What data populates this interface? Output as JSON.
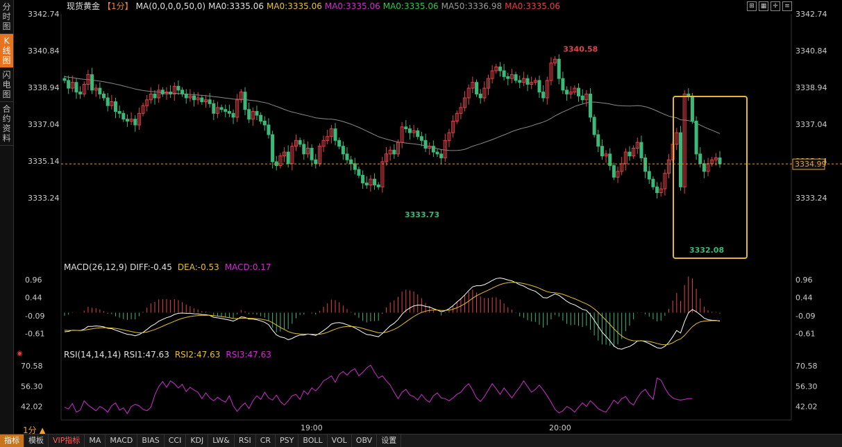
{
  "sidebar": {
    "tabs": [
      {
        "label": "分时图",
        "active": false
      },
      {
        "label": "K线图",
        "active": true
      },
      {
        "label": "闪电图",
        "active": false
      },
      {
        "label": "合约资料",
        "active": false
      }
    ]
  },
  "header": {
    "title": "现货黄金",
    "period_tag": "【1分】",
    "ma_params": "MA(0,0,0,0,50,0)",
    "ma_items": [
      {
        "label": "MA0:3335.06",
        "color": "#e0e0e0"
      },
      {
        "label": "MA0:3335.06",
        "color": "#e8c22a"
      },
      {
        "label": "MA0:3335.06",
        "color": "#d22bd2"
      },
      {
        "label": "MA0:3335.06",
        "color": "#2ec94a"
      },
      {
        "label": "MA50:3336.98",
        "color": "#9a9a9a"
      },
      {
        "label": "MA0:3335.06",
        "color": "#e84040"
      }
    ]
  },
  "colors": {
    "up": "#e8404a",
    "down": "#3cb878",
    "ma50": "#8a8a8a",
    "dif": "#ffffff",
    "dea": "#e8c22a",
    "rsi": "#d22bd2",
    "highlight_box": "#e8b82a",
    "last_price_line": "#e8a030"
  },
  "chart_data": [
    {
      "type": "candlestick",
      "name": "price",
      "ylim": [
        3331.8,
        3342.74
      ],
      "y_ticks": [
        3342.74,
        3340.84,
        3338.94,
        3337.04,
        3335.14,
        3333.24
      ],
      "x_tick_labels": [
        "19:00",
        "20:00"
      ],
      "high_label": "3340.58",
      "low_labels": [
        "3333.73",
        "3332.08"
      ],
      "last_price": "3334.99",
      "ma50_label": "MA50",
      "closes": [
        3339.3,
        3338.9,
        3339.2,
        3338.7,
        3338.6,
        3339.1,
        3339.6,
        3338.8,
        3338.9,
        3338.6,
        3338.4,
        3338.0,
        3338.2,
        3337.7,
        3337.6,
        3337.3,
        3337.2,
        3337.3,
        3337.0,
        3337.6,
        3338.0,
        3338.3,
        3338.6,
        3338.4,
        3338.8,
        3338.6,
        3338.7,
        3338.6,
        3339.0,
        3338.8,
        3338.6,
        3338.4,
        3338.5,
        3338.3,
        3338.4,
        3338.2,
        3338.3,
        3338.1,
        3337.6,
        3337.9,
        3337.8,
        3337.7,
        3337.6,
        3337.4,
        3338.3,
        3338.7,
        3337.8,
        3337.3,
        3337.7,
        3337.5,
        3337.2,
        3337.0,
        3336.5,
        3335.1,
        3334.9,
        3335.4,
        3335.6,
        3335.0,
        3335.9,
        3336.2,
        3336.0,
        3335.5,
        3335.8,
        3335.2,
        3335.0,
        3335.9,
        3336.2,
        3336.4,
        3336.8,
        3336.2,
        3335.9,
        3335.5,
        3335.2,
        3335.0,
        3334.7,
        3334.4,
        3334.0,
        3333.9,
        3334.2,
        3333.9,
        3333.8,
        3335.1,
        3335.5,
        3335.7,
        3335.5,
        3336.1,
        3336.9,
        3336.8,
        3336.6,
        3336.7,
        3336.4,
        3336.2,
        3335.8,
        3335.9,
        3335.6,
        3335.5,
        3335.3,
        3336.2,
        3336.6,
        3337.2,
        3337.6,
        3337.9,
        3338.4,
        3338.9,
        3339.2,
        3338.6,
        3338.4,
        3338.9,
        3339.4,
        3339.8,
        3340.0,
        3339.8,
        3339.5,
        3339.4,
        3339.6,
        3339.3,
        3339.2,
        3339.4,
        3339.1,
        3339.2,
        3339.3,
        3338.7,
        3338.4,
        3339.3,
        3340.2,
        3340.4,
        3339.4,
        3338.8,
        3338.6,
        3338.7,
        3338.9,
        3338.5,
        3338.3,
        3338.6,
        3337.4,
        3336.5,
        3335.9,
        3335.4,
        3335.5,
        3334.9,
        3334.3,
        3334.6,
        3335.0,
        3335.6,
        3335.4,
        3335.8,
        3336.1,
        3335.3,
        3334.6,
        3334.2,
        3333.8,
        3333.5,
        3333.7,
        3334.5,
        3335.2,
        3336.0,
        3336.6,
        3333.8,
        3338.6,
        3338.5,
        3337.2,
        3335.5,
        3335.0,
        3334.6,
        3335.0,
        3335.2,
        3335.3,
        3334.99
      ]
    },
    {
      "type": "line",
      "name": "macd",
      "label": "MACD(26,12,9)",
      "values_text": {
        "dif": "DIFF:-0.45",
        "dea": "DEA:-0.53",
        "macd": "MACD:0.17"
      },
      "ylim": [
        -1.0,
        1.1
      ],
      "y_ticks": [
        "0.96",
        "0.44",
        "-0.09",
        "-0.61"
      ]
    },
    {
      "type": "line",
      "name": "rsi",
      "label": "RSI(14,14,14)",
      "values_text": {
        "rsi1": "RSI1:47.63",
        "rsi2": "RSI2:47.63",
        "rsi3": "RSI3:47.63"
      },
      "ylim": [
        35,
        73
      ],
      "y_ticks": [
        "70.58",
        "56.30",
        "42.02"
      ],
      "values": [
        41.5,
        40.2,
        44.0,
        38.0,
        39.5,
        46.0,
        43.0,
        41.0,
        39.0,
        42.0,
        40.5,
        38.0,
        42.5,
        44.5,
        39.5,
        41.0,
        37.0,
        42.0,
        43.5,
        42.5,
        40.0,
        39.0,
        41.5,
        50.0,
        56.0,
        59.5,
        55.5,
        60.0,
        58.0,
        55.0,
        57.5,
        52.5,
        55.5,
        53.5,
        52.0,
        47.5,
        51.5,
        48.0,
        46.0,
        48.5,
        46.5,
        45.0,
        49.5,
        42.5,
        38.5,
        42.0,
        44.5,
        40.5,
        46.0,
        49.5,
        47.0,
        52.0,
        48.0,
        46.5,
        50.0,
        45.5,
        43.0,
        46.0,
        49.5,
        50.5,
        47.0,
        53.0,
        50.5,
        55.0,
        53.0,
        56.0,
        60.0,
        61.5,
        63.5,
        59.0,
        64.5,
        66.5,
        64.0,
        67.0,
        68.5,
        63.5,
        66.0,
        69.0,
        71.0,
        66.0,
        62.0,
        63.5,
        60.0,
        57.0,
        52.0,
        47.5,
        52.0,
        54.0,
        50.0,
        49.0,
        46.5,
        50.5,
        47.0,
        45.0,
        49.5,
        51.5,
        48.0,
        47.5,
        46.0,
        48.0,
        50.5,
        52.0,
        55.5,
        58.0,
        53.5,
        48.0,
        45.5,
        49.0,
        53.5,
        58.0,
        54.5,
        50.5,
        55.0,
        51.5,
        48.0,
        52.0,
        55.5,
        60.0,
        56.0,
        52.0,
        54.0,
        57.0,
        53.5,
        49.5,
        45.0,
        40.0,
        37.5,
        39.0,
        42.0,
        40.5,
        38.0,
        41.5,
        44.5,
        42.0,
        46.0,
        43.5,
        40.5,
        39.0,
        38.0,
        42.0,
        46.5,
        44.0,
        47.5,
        49.0,
        45.0,
        43.0,
        48.0,
        52.0,
        54.0,
        50.0,
        47.0,
        62.0,
        60.5,
        55.0,
        50.5,
        48.0,
        47.0,
        46.5,
        47.0,
        47.5,
        47.63
      ]
    }
  ],
  "toolbar": {
    "period_label": "1分",
    "items": [
      {
        "label": "指标",
        "kind": "first"
      },
      {
        "label": "模板",
        "kind": "normal"
      },
      {
        "label": "VIP指标",
        "kind": "vip"
      },
      {
        "label": "MA",
        "kind": "normal"
      },
      {
        "label": "MACD",
        "kind": "normal"
      },
      {
        "label": "BIAS",
        "kind": "normal"
      },
      {
        "label": "CCI",
        "kind": "normal"
      },
      {
        "label": "KDJ",
        "kind": "normal"
      },
      {
        "label": "LW&",
        "kind": "normal"
      },
      {
        "label": "RSI",
        "kind": "normal"
      },
      {
        "label": "CR",
        "kind": "normal"
      },
      {
        "label": "PSY",
        "kind": "normal"
      },
      {
        "label": "BOLL",
        "kind": "normal"
      },
      {
        "label": "VOL",
        "kind": "normal"
      },
      {
        "label": "OBV",
        "kind": "normal"
      },
      {
        "label": "设置",
        "kind": "normal"
      }
    ]
  },
  "window_icons": [
    "expand-icon",
    "grid-icon",
    "crosshair-icon",
    "menu-icon"
  ]
}
